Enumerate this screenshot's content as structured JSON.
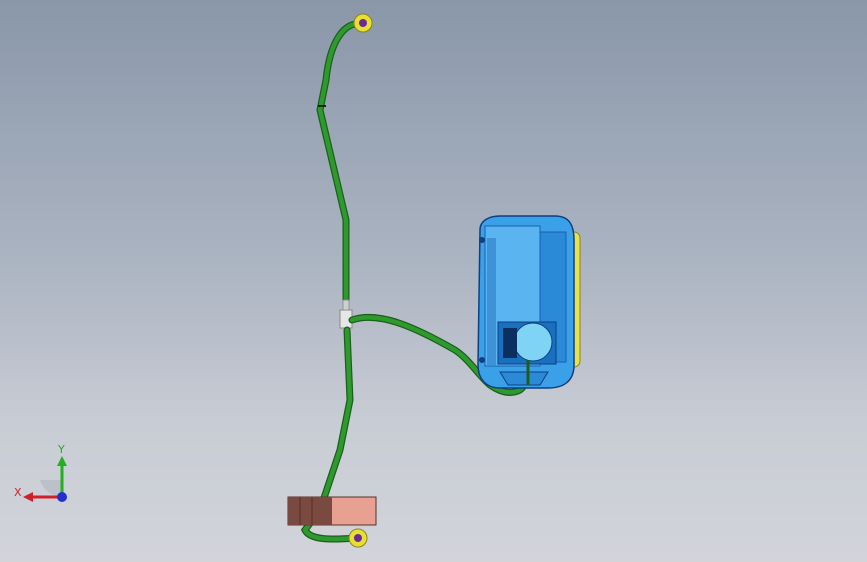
{
  "viewport": {
    "background_top": "#8a97a9",
    "background_bottom": "#d2d4da"
  },
  "model": {
    "hose_color": "#2e9a2e",
    "hose_outline": "#1c5e1c",
    "reservoir_color": "#3aa0e8",
    "reservoir_accent": "#7fd4f5",
    "reservoir_cap_color": "#e8e24a",
    "connector_color": "#e8e030",
    "connector_inner": "#6a2b9a",
    "bracket_dark": "#7a4a40",
    "bracket_light": "#e8a090"
  },
  "triad": {
    "x_label": "X",
    "y_label": "Y",
    "x_color": "#d0202a",
    "y_color": "#20b020",
    "z_color": "#2030d0",
    "icon": "coordinate-triad-icon"
  }
}
